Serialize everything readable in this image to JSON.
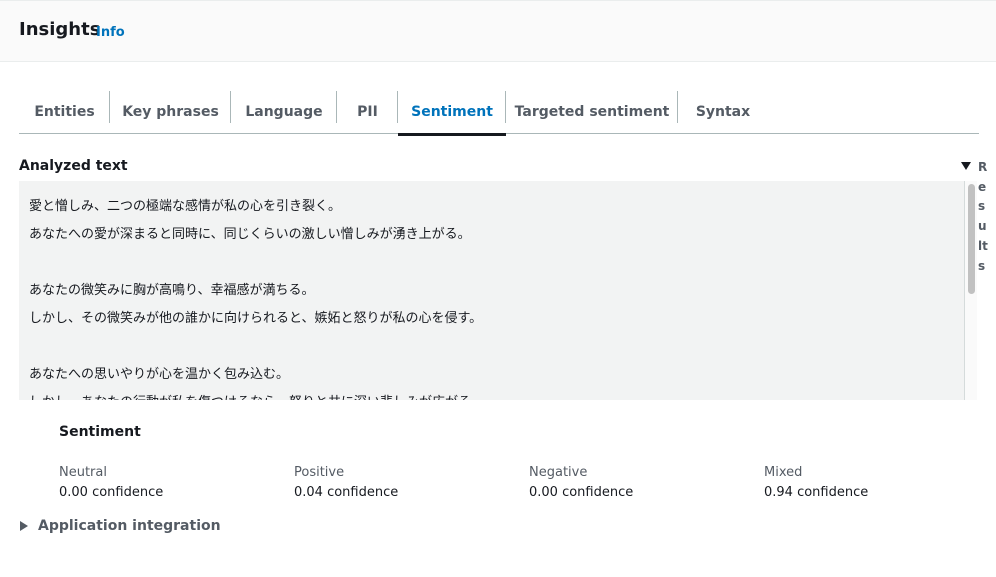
{
  "header": {
    "title": "Insights",
    "info_link": "Info"
  },
  "tabs": [
    {
      "label": "Entities"
    },
    {
      "label": "Key phrases"
    },
    {
      "label": "Language"
    },
    {
      "label": "PII"
    },
    {
      "label": "Sentiment"
    },
    {
      "label": "Targeted sentiment"
    },
    {
      "label": "Syntax"
    }
  ],
  "active_tab": "Sentiment",
  "analyzed": {
    "label": "Analyzed text",
    "lines": [
      "愛と憎しみ、二つの極端な感情が私の心を引き裂く。",
      "あなたへの愛が深まると同時に、同じくらいの激しい憎しみが湧き上がる。",
      "",
      "あなたの微笑みに胸が高鳴り、幸福感が満ちる。",
      "しかし、その微笑みが他の誰かに向けられると、嫉妬と怒りが私の心を侵す。",
      "",
      "あなたへの思いやりが心を温かく包み込む。",
      "しかし、あなたの行動が私を傷つけるなら、怒りと共に深い悲しみが広がる。"
    ]
  },
  "results": {
    "label": "Results"
  },
  "sentiment": {
    "title": "Sentiment",
    "metrics": [
      {
        "label": "Neutral",
        "value": "0.00 confidence"
      },
      {
        "label": "Positive",
        "value": "0.04 confidence"
      },
      {
        "label": "Negative",
        "value": "0.00 confidence"
      },
      {
        "label": "Mixed",
        "value": "0.94 confidence"
      }
    ]
  },
  "app_integration": {
    "label": "Application integration"
  }
}
